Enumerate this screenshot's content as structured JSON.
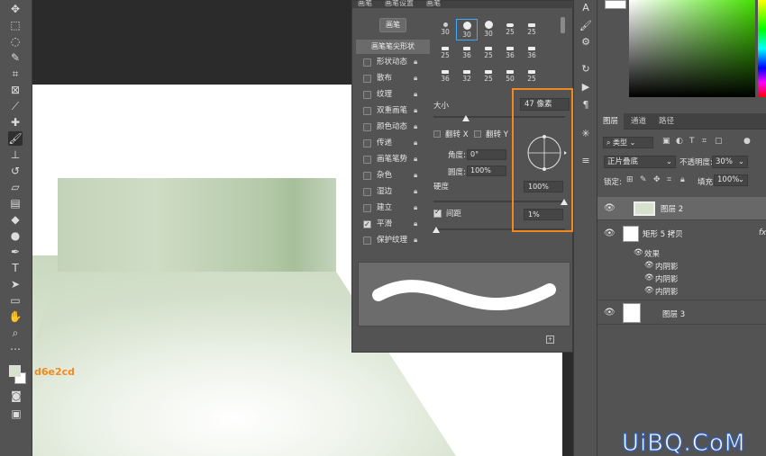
{
  "annotation": {
    "color_hex": "d6e2cd"
  },
  "colors": {
    "foreground": "#d6e2cd",
    "highlight": "#f08a1c"
  },
  "brush_panel": {
    "tabs": [
      "画笔",
      "画笔设置",
      "画笔"
    ],
    "brush_button": "画笔",
    "tip_shape_header": "画笔笔尖形状",
    "options": [
      {
        "label": "形状动态",
        "checked": false
      },
      {
        "label": "散布",
        "checked": false
      },
      {
        "label": "纹理",
        "checked": false
      },
      {
        "label": "双重画笔",
        "checked": false
      },
      {
        "label": "颜色动态",
        "checked": false
      },
      {
        "label": "传递",
        "checked": false
      },
      {
        "label": "画笔笔势",
        "checked": false
      },
      {
        "label": "杂色",
        "checked": false
      },
      {
        "label": "湿边",
        "checked": false
      },
      {
        "label": "建立",
        "checked": false
      },
      {
        "label": "平滑",
        "checked": true
      },
      {
        "label": "保护纹理",
        "checked": false
      }
    ],
    "brush_sizes": [
      "30",
      "30",
      "30",
      "25",
      "25",
      "25",
      "36",
      "25",
      "36",
      "36",
      "36",
      "32",
      "25",
      "50",
      "25"
    ],
    "size_label": "大小",
    "size_value": "47 像素",
    "flip_x": "翻转 X",
    "flip_y": "翻转 Y",
    "angle_label": "角度:",
    "angle_value": "0°",
    "roundness_label": "圆度:",
    "roundness_value": "100%",
    "hardness_label": "硬度",
    "hardness_value": "100%",
    "spacing_label": "间距",
    "spacing_value": "1%"
  },
  "layers_panel": {
    "tabs": [
      "图层",
      "通道",
      "路径"
    ],
    "filter_label": "类型",
    "blend_mode": "正片叠底",
    "opacity_label": "不透明度:",
    "opacity_value": "30%",
    "lock_label": "锁定:",
    "fill_label": "填充:",
    "fill_value": "100%",
    "layers": [
      {
        "name": "图层 2",
        "selected": true
      },
      {
        "name": "矩形 5 拷贝",
        "selected": false
      },
      {
        "name": "图层 3",
        "selected": false
      }
    ],
    "effects_label": "效果",
    "effects": [
      "内阴影",
      "内阴影",
      "内阴影"
    ]
  },
  "watermark": "UiBQ.CoM"
}
